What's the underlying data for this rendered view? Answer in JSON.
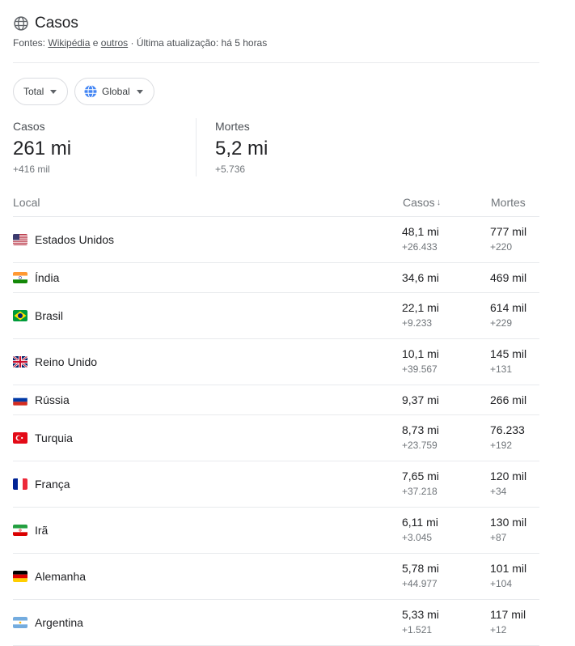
{
  "header": {
    "title": "Casos",
    "sources_prefix": "Fontes:",
    "source_1": "Wikipédia",
    "source_and": "e",
    "source_2": "outros",
    "updated": "· Última atualização: há 5 horas"
  },
  "filters": {
    "total_label": "Total",
    "global_label": "Global"
  },
  "summary": {
    "cases_label": "Casos",
    "cases_value": "261 mi",
    "cases_delta": "+416 mil",
    "deaths_label": "Mortes",
    "deaths_value": "5,2 mi",
    "deaths_delta": "+5.736"
  },
  "table": {
    "headers": {
      "local": "Local",
      "cases": "Casos",
      "deaths": "Mortes"
    },
    "rows": [
      {
        "country": "Estados Unidos",
        "flag": "us-flag-icon",
        "cases": "48,1 mi",
        "cases_delta": "+26.433",
        "deaths": "777 mil",
        "deaths_delta": "+220"
      },
      {
        "country": "Índia",
        "flag": "india-flag-icon",
        "cases": "34,6 mi",
        "cases_delta": "",
        "deaths": "469 mil",
        "deaths_delta": ""
      },
      {
        "country": "Brasil",
        "flag": "brazil-flag-icon",
        "cases": "22,1 mi",
        "cases_delta": "+9.233",
        "deaths": "614 mil",
        "deaths_delta": "+229"
      },
      {
        "country": "Reino Unido",
        "flag": "uk-flag-icon",
        "cases": "10,1 mi",
        "cases_delta": "+39.567",
        "deaths": "145 mil",
        "deaths_delta": "+131"
      },
      {
        "country": "Rússia",
        "flag": "russia-flag-icon",
        "cases": "9,37 mi",
        "cases_delta": "",
        "deaths": "266 mil",
        "deaths_delta": ""
      },
      {
        "country": "Turquia",
        "flag": "turkey-flag-icon",
        "cases": "8,73 mi",
        "cases_delta": "+23.759",
        "deaths": "76.233",
        "deaths_delta": "+192"
      },
      {
        "country": "França",
        "flag": "france-flag-icon",
        "cases": "7,65 mi",
        "cases_delta": "+37.218",
        "deaths": "120 mil",
        "deaths_delta": "+34"
      },
      {
        "country": "Irã",
        "flag": "iran-flag-icon",
        "cases": "6,11 mi",
        "cases_delta": "+3.045",
        "deaths": "130 mil",
        "deaths_delta": "+87"
      },
      {
        "country": "Alemanha",
        "flag": "germany-flag-icon",
        "cases": "5,78 mi",
        "cases_delta": "+44.977",
        "deaths": "101 mil",
        "deaths_delta": "+104"
      },
      {
        "country": "Argentina",
        "flag": "argentina-flag-icon",
        "cases": "5,33 mi",
        "cases_delta": "+1.521",
        "deaths": "117 mil",
        "deaths_delta": "+12"
      }
    ]
  }
}
